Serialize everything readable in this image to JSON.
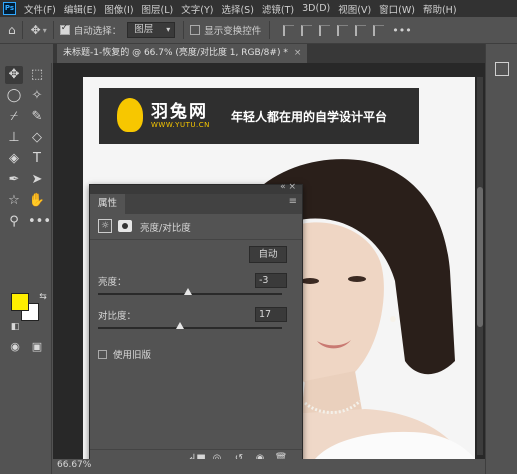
{
  "app": {
    "logo_text": "Ps"
  },
  "menu": [
    "文件(F)",
    "编辑(E)",
    "图像(I)",
    "图层(L)",
    "文字(Y)",
    "选择(S)",
    "滤镜(T)",
    "3D(D)",
    "视图(V)",
    "窗口(W)",
    "帮助(H)"
  ],
  "options": {
    "auto_select_label": "自动选择：",
    "auto_select_checked": true,
    "target_select": "图层",
    "show_transform_label": "显示变换控件",
    "show_transform_checked": false
  },
  "document": {
    "tab_title": "未标题-1-恢复的 @ 66.7% (亮度/对比度 1, RGB/8#) *",
    "close_glyph": "×"
  },
  "canvas": {
    "brand": "羽兔网",
    "url": "WWW.YUTU.CN",
    "slogan": "年轻人都在用的自学设计平台"
  },
  "properties": {
    "tab_label": "属性",
    "layer_label": "亮度/对比度",
    "auto_button": "自动",
    "brightness": {
      "label": "亮度：",
      "value": "-3",
      "min": -150,
      "max": 150
    },
    "contrast": {
      "label": "对比度：",
      "value": "17",
      "min": -50,
      "max": 100
    },
    "use_legacy_label": "使用旧版",
    "use_legacy_checked": false
  },
  "status": {
    "zoom": "66.67%"
  },
  "colors": {
    "foreground": "#ffee00",
    "background": "#ffffff",
    "ps_blue": "#31a8ff",
    "brand_yellow": "#f7c700"
  }
}
